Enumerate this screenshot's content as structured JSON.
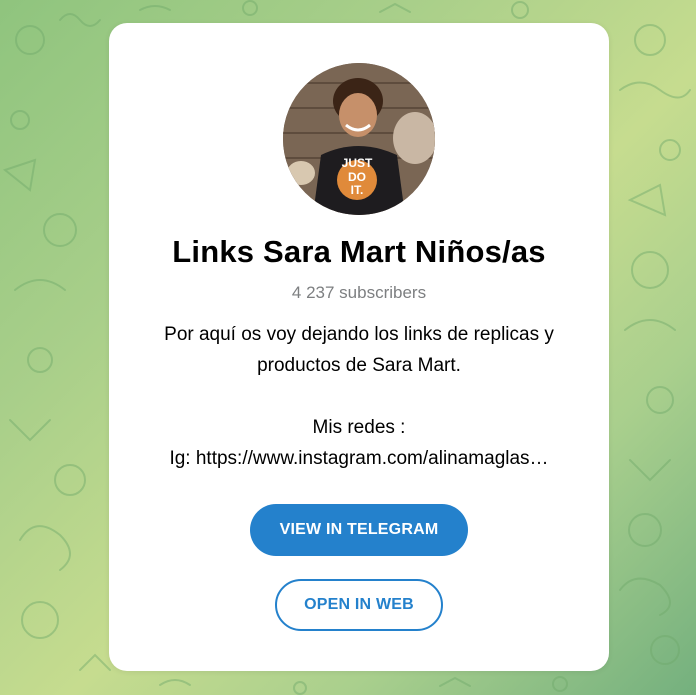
{
  "channel": {
    "title": "Links Sara Mart Niños/as",
    "subscribers": "4 237 subscribers",
    "description_lines": [
      "Por aquí os voy dejando los links de replicas y",
      "productos de Sara Mart.",
      "Mis redes :",
      "Ig: https://www.instagram.com/alinamaglas…"
    ],
    "avatar_icon": "child-photo-avatar",
    "shirt_text": "JUST DO IT."
  },
  "buttons": {
    "view_in_telegram": "VIEW IN TELEGRAM",
    "open_in_web": "OPEN IN WEB"
  },
  "colors": {
    "accent": "#2481cc",
    "background_green": "#9fcb86",
    "card": "#ffffff",
    "muted_text": "#7d7f81"
  }
}
